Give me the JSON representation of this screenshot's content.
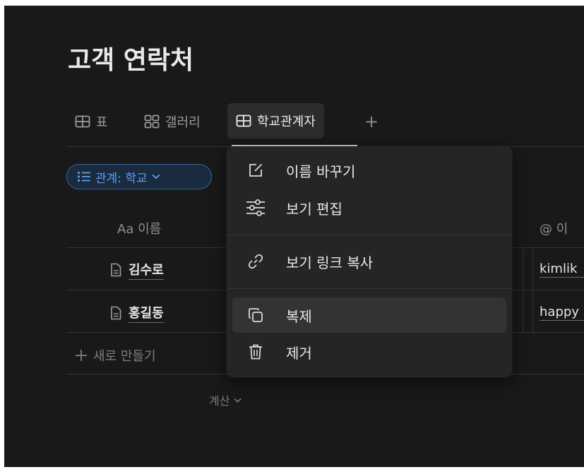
{
  "page": {
    "title": "고객 연락처"
  },
  "tabs": [
    {
      "label": "표",
      "icon": "table-icon"
    },
    {
      "label": "갤러리",
      "icon": "gallery-icon"
    },
    {
      "label": "학교관계자",
      "icon": "table-icon",
      "active": true
    }
  ],
  "add_view_label": "+",
  "filter": {
    "label": "관계: 학교"
  },
  "table": {
    "columns": [
      {
        "prefix": "Aa",
        "label": "이름"
      },
      {
        "prefix": "@",
        "label": "이"
      }
    ],
    "rows": [
      {
        "name": "김수로",
        "email": "kimlik"
      },
      {
        "name": "홍길동",
        "email": "happy"
      }
    ],
    "new_row_label": "새로 만들기",
    "calc_label": "계산"
  },
  "context_menu": {
    "items": [
      {
        "label": "이름 바꾸기",
        "icon": "rename-icon"
      },
      {
        "label": "보기 편집",
        "icon": "settings-sliders-icon"
      },
      {
        "label": "보기 링크 복사",
        "icon": "link-icon"
      },
      {
        "label": "복제",
        "icon": "duplicate-icon",
        "hovered": true
      },
      {
        "label": "제거",
        "icon": "trash-icon"
      }
    ]
  },
  "colors": {
    "background": "#191919",
    "menu_background": "#252525",
    "accent_blue": "#5aa2f0"
  }
}
